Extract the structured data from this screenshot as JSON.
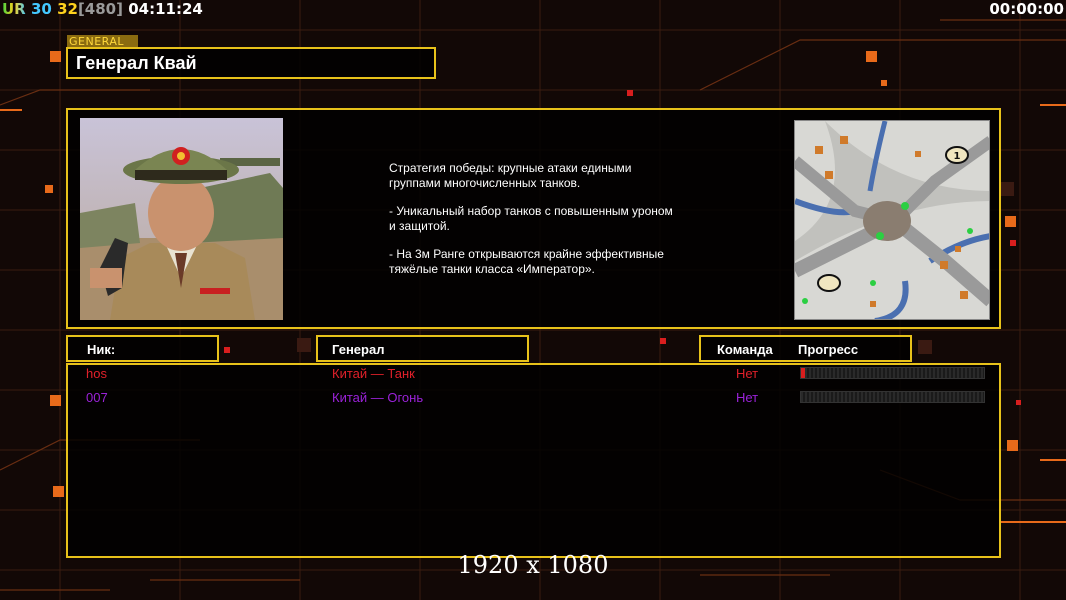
{
  "hud": {
    "tag": "UR",
    "num1": "30",
    "num2": "32",
    "num3": "[480]",
    "clock": "04:11:24",
    "timer": "00:00:00"
  },
  "general_tag": "GENERAL",
  "general_name": "Генерал Квай",
  "description": [
    "Стратегия победы: крупные атаки едиными\n группами многочисленных танков.",
    "- Уникальный набор танков с повышенным уроном\n и защитой.",
    "- На 3м Ранге открываются крайне эффективные\n тяжёлые танки класса «Император»."
  ],
  "headers": {
    "nick": "Ник:",
    "general": "Генерал",
    "team": "Команда",
    "progress": "Прогресс"
  },
  "players": [
    {
      "nick": "hos",
      "general": "Китай — Танк",
      "team": "Нет",
      "progress": 0.02,
      "color": "#e0202a"
    },
    {
      "nick": "007",
      "general": "Китай — Огонь",
      "team": "Нет",
      "progress": 0.0,
      "color": "#9a22d8"
    }
  ],
  "map_markers": [
    "1"
  ],
  "resolution": "1920 x 1080",
  "colors": {
    "frame": "#e8c21a",
    "hud_green": "#3fd23f",
    "hud_cyan": "#44c8ff",
    "hud_yellow": "#ffd21e"
  }
}
